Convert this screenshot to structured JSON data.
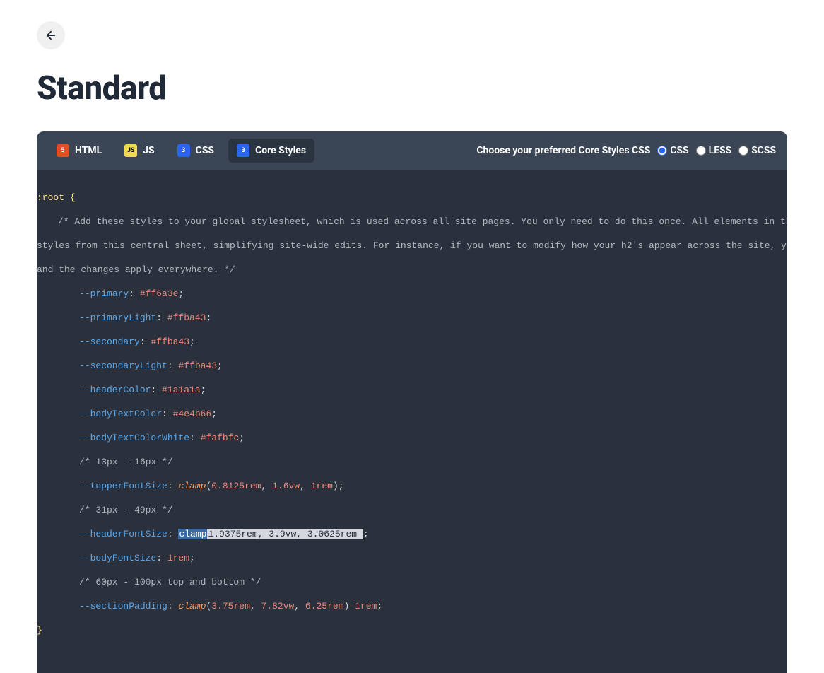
{
  "header": {
    "title": "Standard"
  },
  "tabs": {
    "html": "HTML",
    "js": "JS",
    "css": "CSS",
    "core_styles": "Core Styles"
  },
  "format_picker": {
    "label": "Choose your preferred Core Styles CSS",
    "css": "CSS",
    "less": "LESS",
    "scss": "SCSS"
  },
  "code": {
    "root_open": ":root {",
    "comment_main": "/* Add these styles to your global stylesheet, which is used across all site pages. You only need to do this once. All elements in the libra",
    "comment_cont1": "styles from this central sheet, simplifying site-wide edits. For instance, if you want to modify how your h2's appear across the site, you just ",
    "comment_cont2": "and the changes apply everywhere. */",
    "var_primary": "--primary",
    "val_primary": "#ff6a3e",
    "var_primaryLight": "--primaryLight",
    "val_primaryLight": "#ffba43",
    "var_secondary": "--secondary",
    "val_secondary": "#ffba43",
    "var_secondaryLight": "--secondaryLight",
    "val_secondaryLight": "#ffba43",
    "var_headerColor": "--headerColor",
    "val_headerColor": "#1a1a1a",
    "var_bodyTextColor": "--bodyTextColor",
    "val_bodyTextColor": "#4e4b66",
    "var_bodyTextColorWhite": "--bodyTextColorWhite",
    "val_bodyTextColorWhite": "#fafbfc",
    "comment_topper_px": "/* 13px - 16px */",
    "var_topperFontSize": "--topperFontSize",
    "func_clamp": "clamp",
    "val_topper_a": "0.8125rem",
    "val_topper_b": "1.6vw",
    "val_topper_c": "1rem",
    "comment_header_px": "/* 31px - 49px */",
    "var_headerFontSize": "--headerFontSize",
    "hl_clamp": "clamp",
    "hl_args": "1.9375rem, 3.9vw, 3.0625rem ",
    "var_bodyFontSize": "--bodyFontSize",
    "val_bodyFontSize": "1rem",
    "comment_section_px": "/* 60px - 100px top and bottom */",
    "var_sectionPadding": "--sectionPadding",
    "val_section_a": "3.75rem",
    "val_section_b": "7.82vw",
    "val_section_c": "6.25rem",
    "val_section_d": "1rem",
    "root_close": "}"
  }
}
